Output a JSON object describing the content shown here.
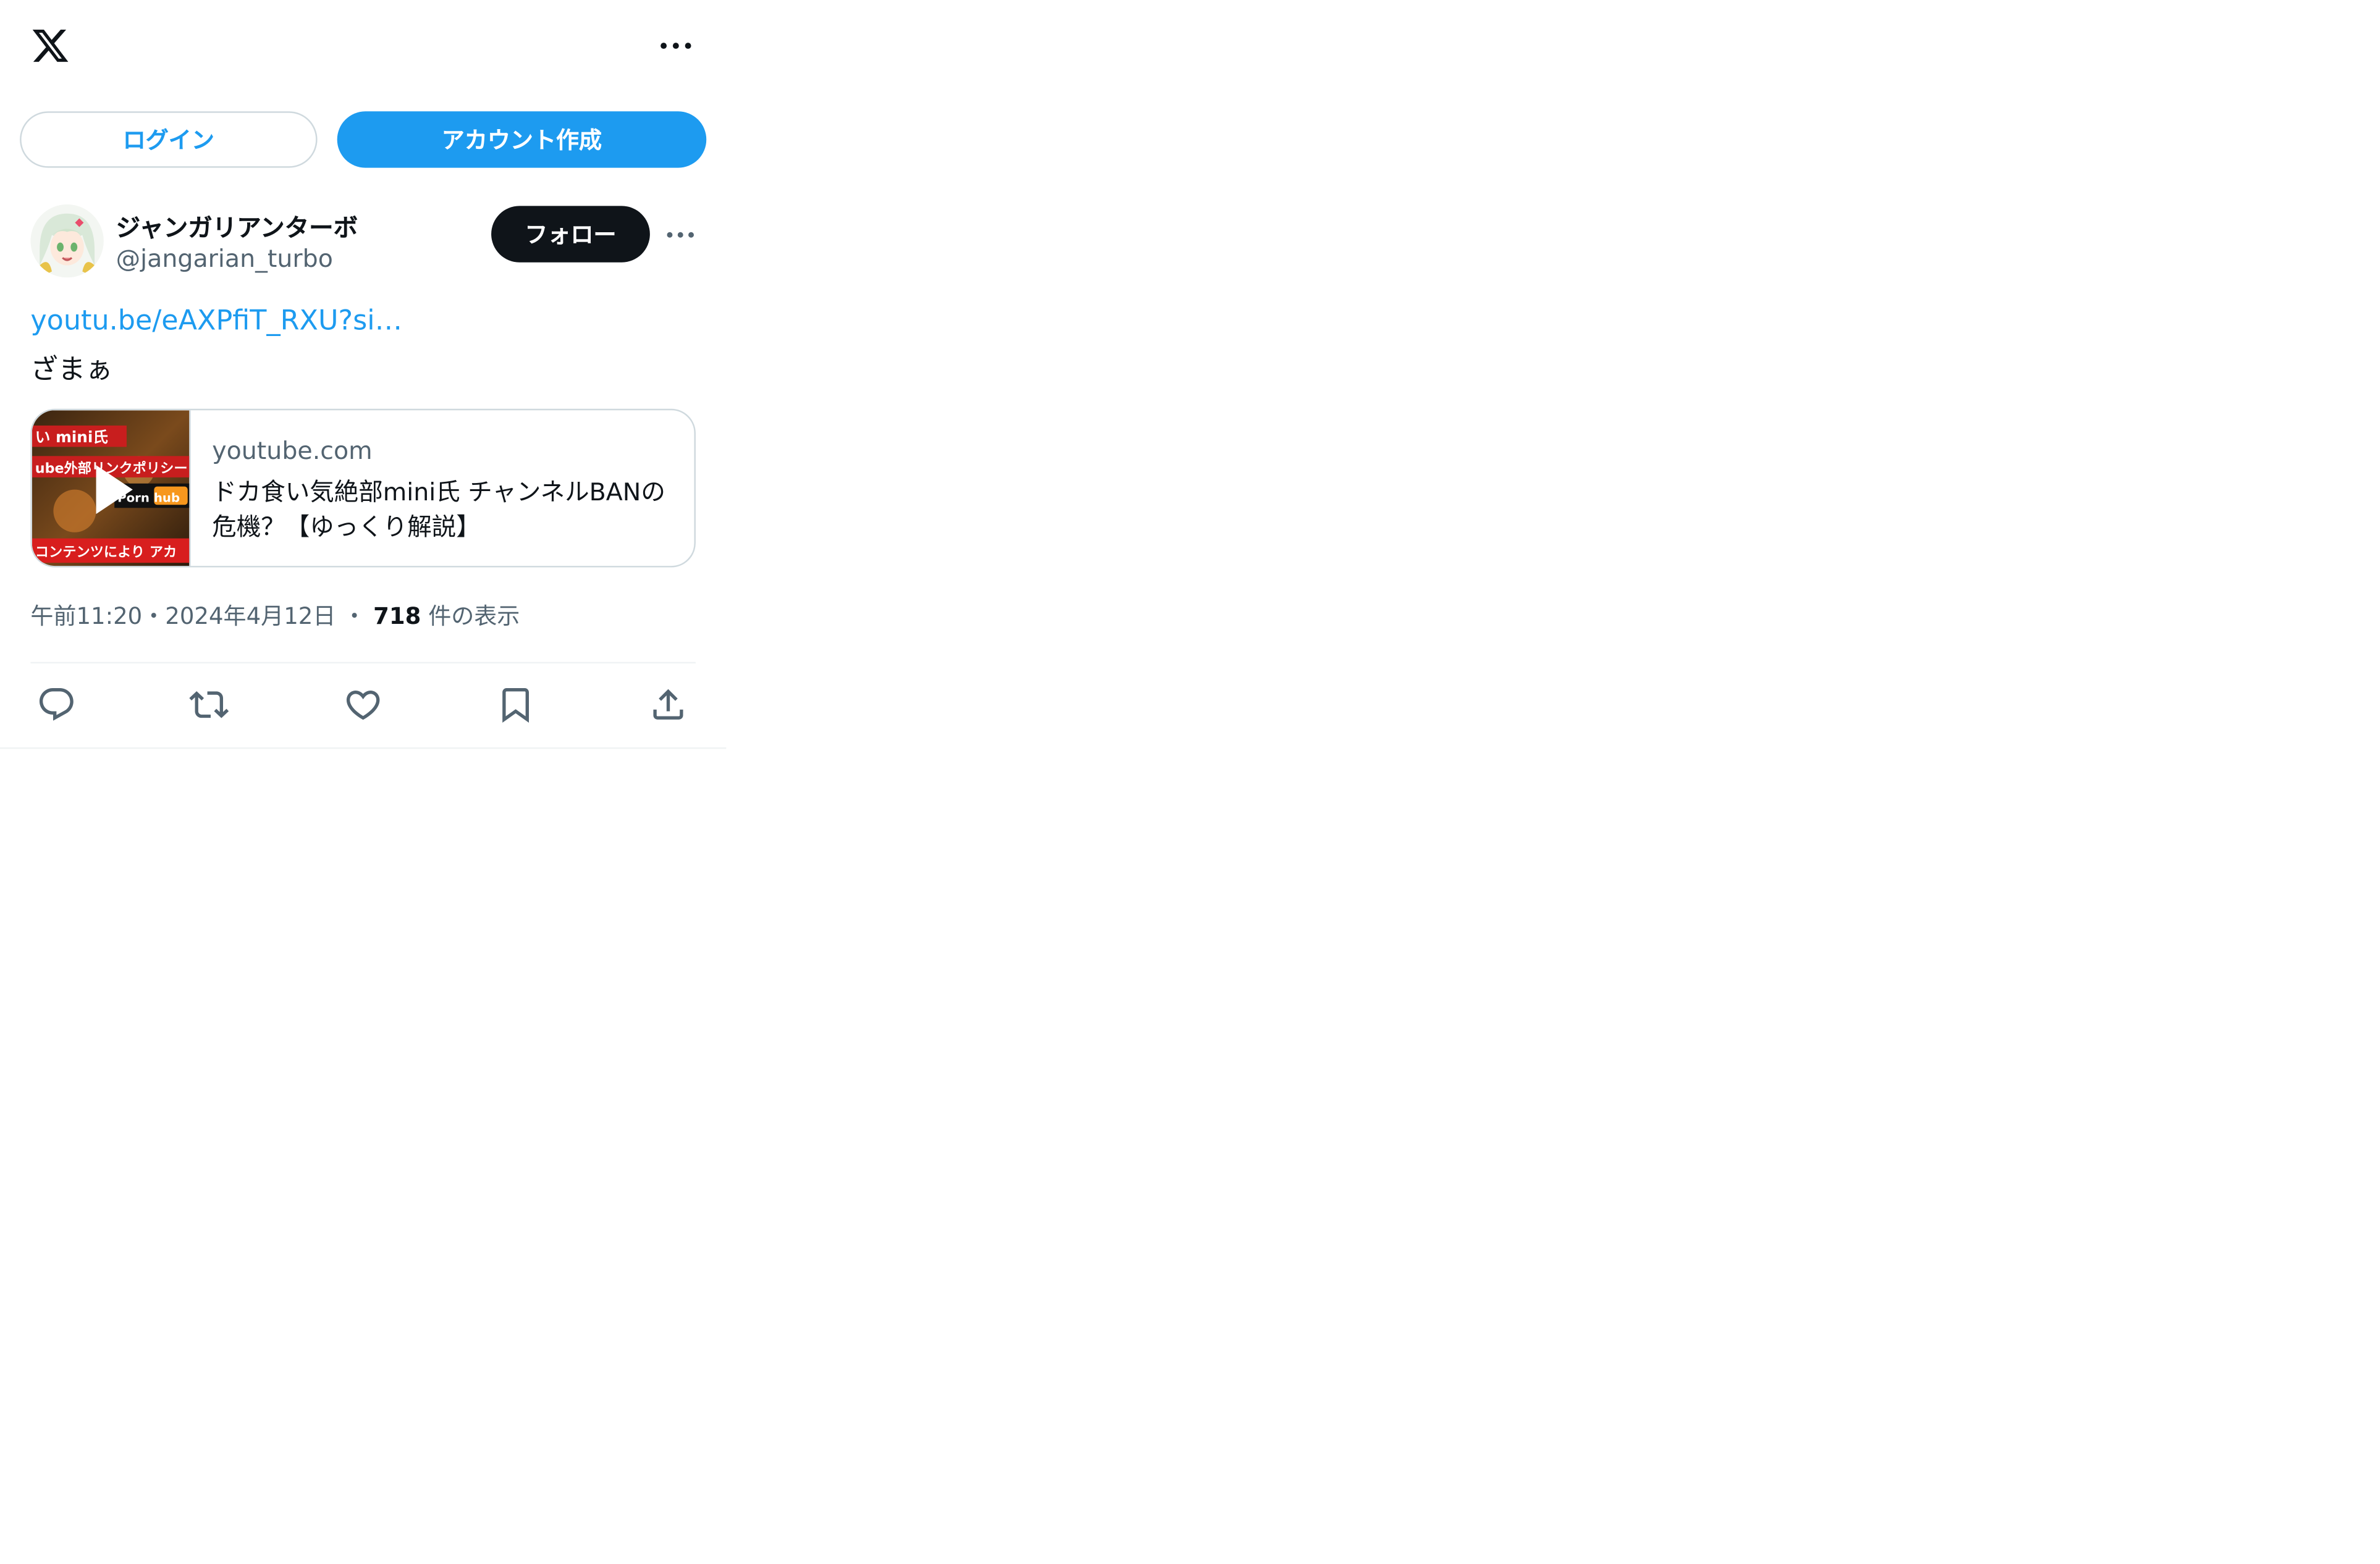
{
  "header": {
    "logo_icon": "x-logo-icon",
    "more_icon": "more-horizontal-icon"
  },
  "auth": {
    "login_label": "ログイン",
    "signup_label": "アカウント作成"
  },
  "tweet": {
    "author": {
      "display_name": "ジャンガリアンターボ",
      "handle": "@jangarian_turbo"
    },
    "follow_label": "フォロー",
    "link_text": "youtu.be/eAXPfiT_RXU?si…",
    "text": "ざまぁ",
    "card": {
      "domain": "youtube.com",
      "title": "ドカ食い気絶部mini氏 チャンネルBANの危機？【ゆっくり解説】",
      "thumb_lines": [
        "い mini氏",
        "ube外部リンクポリシー",
        "Porn hub",
        "コンテンツにより アカ"
      ]
    },
    "meta": {
      "time": "午前11:20",
      "separator": "・",
      "date": "2024年4月12日",
      "separator2": "・",
      "views_count": "718",
      "views_label": "件の表示"
    },
    "actions": [
      "reply-icon",
      "retweet-icon",
      "like-icon",
      "bookmark-icon",
      "share-icon"
    ]
  },
  "colors": {
    "accent": "#1d9bf0",
    "text": "#0f1419",
    "secondary": "#536471",
    "border": "#cfd9de"
  }
}
